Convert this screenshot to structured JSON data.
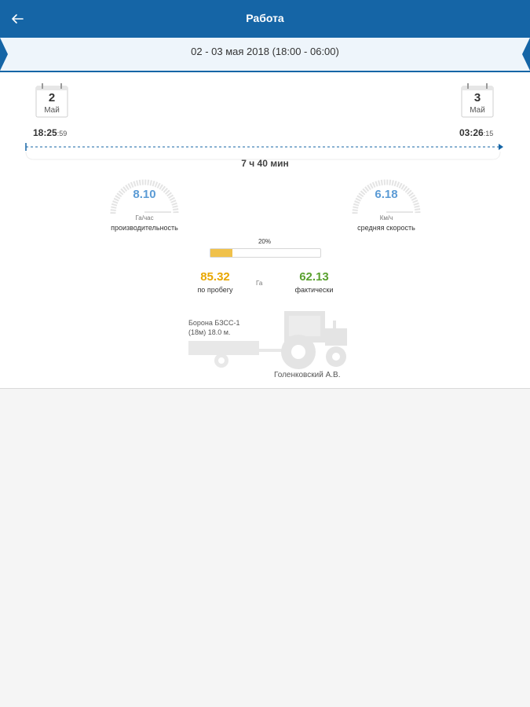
{
  "header": {
    "title": "Работа"
  },
  "period": {
    "label": "02 - 03 мая 2018 (18:00 - 06:00)"
  },
  "start": {
    "day": "2",
    "month": "Май",
    "time_main": "18:25",
    "time_sec": ":59"
  },
  "end": {
    "day": "3",
    "month": "Май",
    "time_main": "03:26",
    "time_sec": ":15"
  },
  "duration": "7 ч 40 мин",
  "productivity": {
    "value": "8.10",
    "unit": "Га/час",
    "label": "производительность"
  },
  "speed": {
    "value": "6.18",
    "unit": "Км/ч",
    "label": "средняя скорость"
  },
  "progress": {
    "percent_label": "20%",
    "fraction": 0.2
  },
  "mileage_area": {
    "value": "85.32",
    "label": "по пробегу",
    "color": "#e8a700"
  },
  "unit_center": "Га",
  "actual_area": {
    "value": "62.13",
    "label": "фактически",
    "color": "#5aa12f"
  },
  "implement": {
    "line1": "Борона БЗСС-1",
    "line2": "(18м) 18.0 м."
  },
  "driver": "Голенковский А.В.",
  "colors": {
    "appbar": "#1565a6",
    "accent": "#5b9bd5",
    "ribbon": "#eef5fb"
  }
}
